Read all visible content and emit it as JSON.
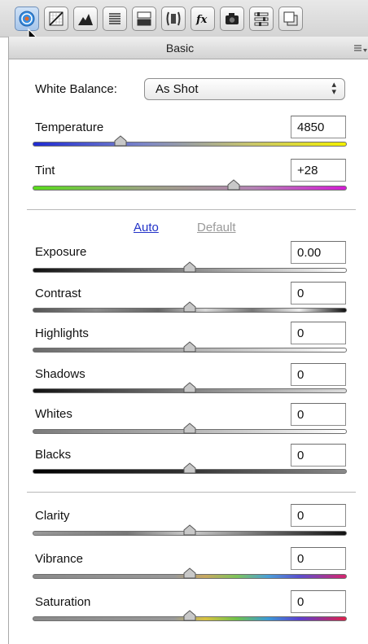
{
  "toolbar": {
    "tabs": [
      {
        "name": "basic-icon",
        "active": true
      },
      {
        "name": "tone-curve-icon"
      },
      {
        "name": "detail-icon"
      },
      {
        "name": "hsl-grayscale-icon"
      },
      {
        "name": "split-toning-icon"
      },
      {
        "name": "lens-corrections-icon"
      },
      {
        "name": "effects-icon",
        "glyph": "fx"
      },
      {
        "name": "camera-calibration-icon"
      },
      {
        "name": "presets-icon"
      },
      {
        "name": "snapshots-icon"
      }
    ]
  },
  "panel": {
    "title": "Basic",
    "white_balance": {
      "label": "White Balance:",
      "value": "As Shot"
    },
    "auto_label": "Auto",
    "default_label": "Default",
    "sliders": {
      "temperature": {
        "label": "Temperature",
        "value": "4850",
        "position": 0.28
      },
      "tint": {
        "label": "Tint",
        "value": "+28",
        "position": 0.64
      },
      "exposure": {
        "label": "Exposure",
        "value": "0.00",
        "position": 0.5
      },
      "contrast": {
        "label": "Contrast",
        "value": "0",
        "position": 0.5
      },
      "highlights": {
        "label": "Highlights",
        "value": "0",
        "position": 0.5
      },
      "shadows": {
        "label": "Shadows",
        "value": "0",
        "position": 0.5
      },
      "whites": {
        "label": "Whites",
        "value": "0",
        "position": 0.5
      },
      "blacks": {
        "label": "Blacks",
        "value": "0",
        "position": 0.5
      },
      "clarity": {
        "label": "Clarity",
        "value": "0",
        "position": 0.5
      },
      "vibrance": {
        "label": "Vibrance",
        "value": "0",
        "position": 0.5
      },
      "saturation": {
        "label": "Saturation",
        "value": "0",
        "position": 0.5
      }
    }
  },
  "colors": {
    "link_active": "#2232c8",
    "link_inactive": "#9a9a9a"
  }
}
